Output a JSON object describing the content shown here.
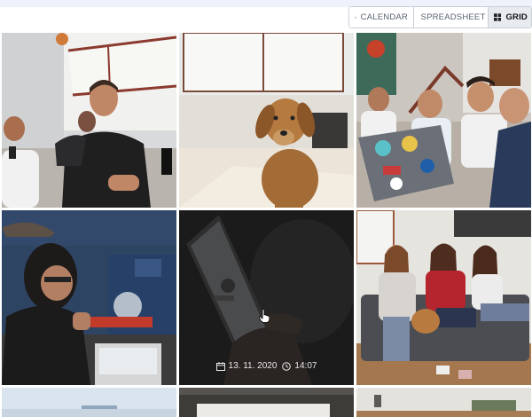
{
  "toolbar": {
    "views": [
      {
        "label": "CALENDAR",
        "icon": "calendar-icon",
        "active": false
      },
      {
        "label": "SPREADSHEET",
        "icon": "spreadsheet-icon",
        "active": false
      },
      {
        "label": "GRID",
        "icon": "grid-icon",
        "active": true
      }
    ]
  },
  "grid": {
    "tiles": [
      {
        "name": "photo-team-laughing"
      },
      {
        "name": "photo-dog-office"
      },
      {
        "name": "photo-team-laptop-stickers"
      },
      {
        "name": "photo-woman-glasses-desk"
      },
      {
        "name": "photo-phone-dark",
        "hovered": true,
        "date": "13. 11. 2020",
        "time": "14:07"
      },
      {
        "name": "photo-three-women-sofa"
      }
    ]
  }
}
